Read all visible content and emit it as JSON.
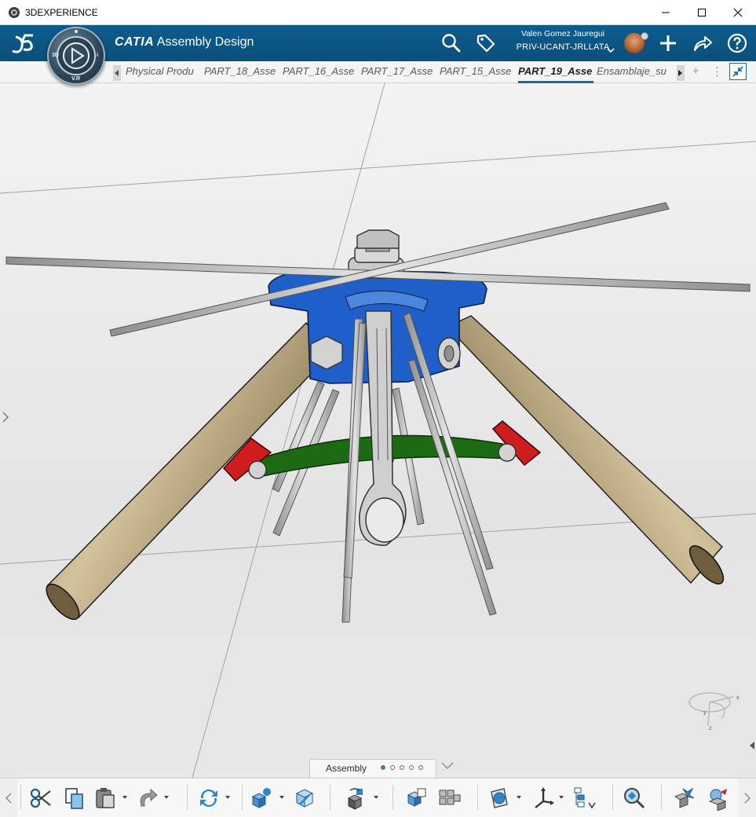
{
  "window": {
    "title": "3DEXPERIENCE"
  },
  "header": {
    "brand": "CATIA",
    "app": "Assembly Design",
    "user_name": "Valen Gomez Jauregui",
    "tenant": "PRIV-UCANT-JRLLATA",
    "compass_labels": {
      "top": "3D",
      "right": "i",
      "bottom": "V.R"
    }
  },
  "tabs": [
    {
      "label": "Physical Produ",
      "active": false
    },
    {
      "label": "PART_18_Asse",
      "active": false
    },
    {
      "label": "PART_16_Asse",
      "active": false
    },
    {
      "label": "PART_17_Asse",
      "active": false
    },
    {
      "label": "PART_15_Asse",
      "active": false
    },
    {
      "label": "PART_19_Asse",
      "active": true
    },
    {
      "label": "Ensamblaje_su",
      "active": false
    }
  ],
  "tab_tools": {
    "add": "+",
    "more": "⋮"
  },
  "viewport": {
    "colors": {
      "tubes": "#b9a57c",
      "hub": "#1f5fc9",
      "link": "#1d6a14",
      "clevis": "#cf1d1d",
      "rods": "#b7b7b7"
    },
    "axis_labels": {
      "x": "x",
      "y": "y",
      "z": "z"
    }
  },
  "section": {
    "name": "Assembly",
    "pages": 5,
    "active_page": 1
  },
  "toolbar": {
    "groups": [
      [
        "cut-icon",
        "copy-icon",
        "paste-icon",
        "redo-icon"
      ],
      [
        "update-icon"
      ],
      [
        "insert-product-icon",
        "replace-component-icon"
      ],
      [
        "snap-icon"
      ],
      [
        "instance-icon",
        "pattern-icon"
      ],
      [
        "section-view-icon",
        "robot-icon",
        "tree-reorder-icon"
      ],
      [
        "zoom-inspect-icon"
      ],
      [
        "clash-icon",
        "clearance-icon"
      ]
    ]
  }
}
